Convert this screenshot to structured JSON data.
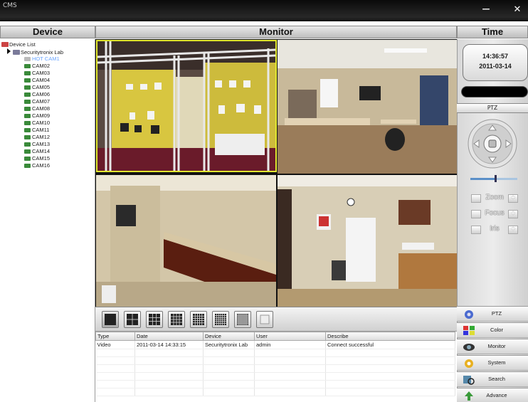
{
  "window": {
    "title": "CMS",
    "minimize": "—",
    "close": "✕"
  },
  "panels": {
    "device": "Device",
    "monitor": "Monitor",
    "time": "Time"
  },
  "tree": {
    "root": "Device List",
    "group": "Securitytronix Lab",
    "cameras": [
      "HOT CAM1",
      "CAM02",
      "CAM03",
      "CAM04",
      "CAM05",
      "CAM06",
      "CAM07",
      "CAM08",
      "CAM09",
      "CAM10",
      "CAM11",
      "CAM12",
      "CAM13",
      "CAM14",
      "CAM15",
      "CAM16"
    ],
    "selected_camera": "HOT CAM1"
  },
  "clock": {
    "time": "14:36:57",
    "date": "2011-03-14"
  },
  "ptz": {
    "title": "PTZ",
    "zoom": "Zoom",
    "focus": "Focus",
    "iris": "Iris"
  },
  "layouts": [
    "single-view",
    "quad-view",
    "9-view",
    "16-view",
    "25-view",
    "36-view",
    "64-view",
    "fullscreen"
  ],
  "log": {
    "columns": [
      "Type",
      "Date",
      "Device",
      "User",
      "Describe"
    ],
    "rows": [
      [
        "Video",
        "2011-03-14 14:33:15",
        "Securitytronix Lab",
        "admin",
        "Connect successful"
      ]
    ]
  },
  "menu": [
    "PTZ",
    "Color",
    "Monitor",
    "System",
    "Search",
    "Advance"
  ],
  "colors": {
    "active_tile": "#e2e830",
    "selected_tree": "#6aa5ff"
  }
}
